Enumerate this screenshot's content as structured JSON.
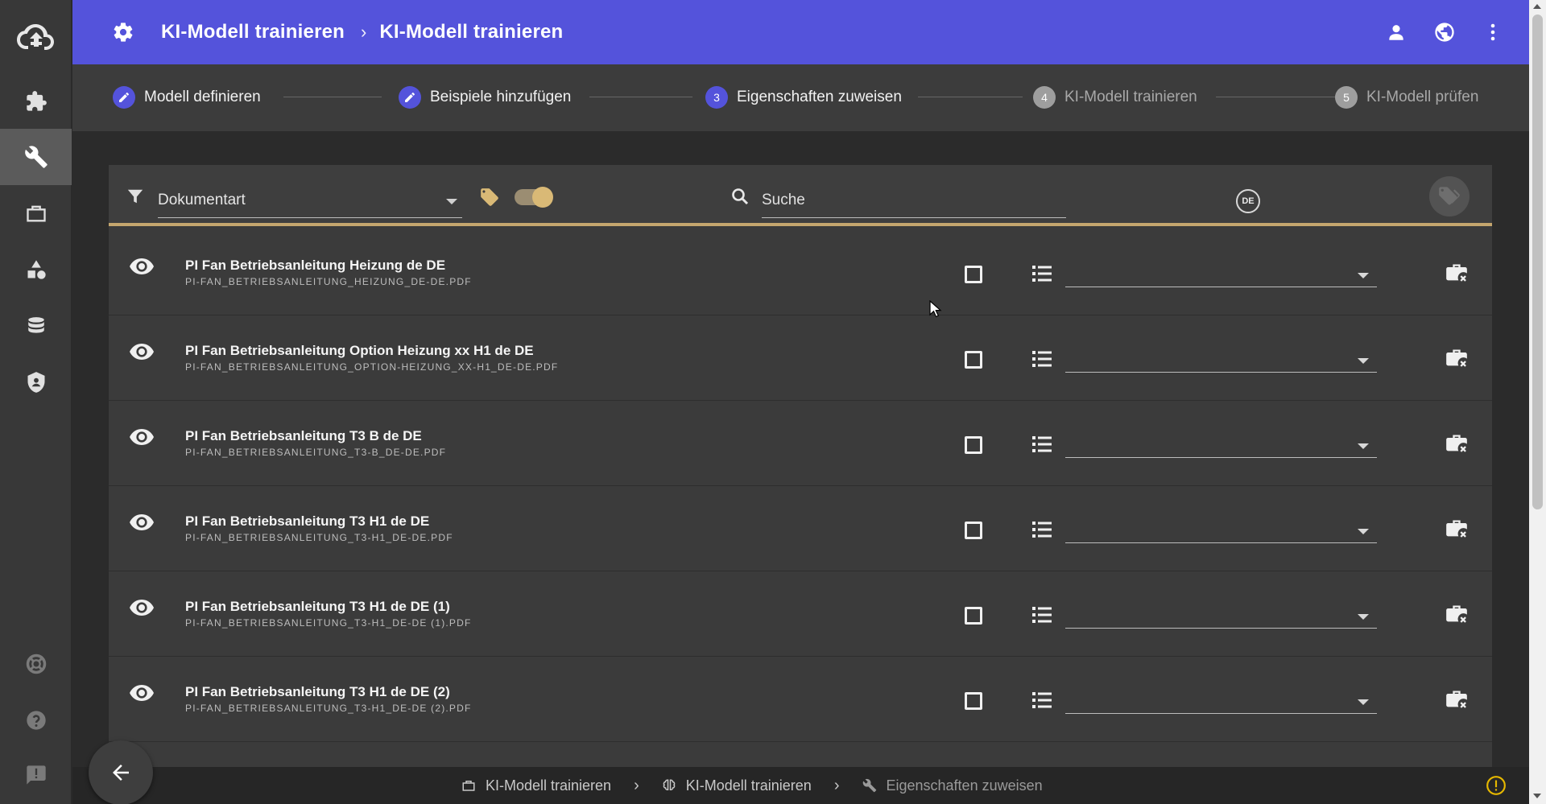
{
  "header": {
    "title": "KI-Modell trainieren",
    "separator": "›",
    "subtitle": "KI-Modell trainieren",
    "bg_color": "#5453db"
  },
  "sidebar": {
    "items": [
      {
        "icon": "puzzle-icon",
        "active": false
      },
      {
        "icon": "wrench-icon",
        "active": true
      },
      {
        "icon": "briefcase-icon",
        "active": false
      },
      {
        "icon": "shapes-icon",
        "active": false
      },
      {
        "icon": "database-icon",
        "active": false
      },
      {
        "icon": "shield-icon",
        "active": false
      }
    ],
    "bottom_items": [
      {
        "icon": "lifebuoy-icon"
      },
      {
        "icon": "help-icon"
      },
      {
        "icon": "feedback-icon"
      }
    ]
  },
  "stepper": {
    "steps": [
      {
        "label": "Modell definieren",
        "state": "done",
        "number": ""
      },
      {
        "label": "Beispiele hinzufügen",
        "state": "done",
        "number": ""
      },
      {
        "label": "Eigenschaften zuweisen",
        "state": "active",
        "number": "3"
      },
      {
        "label": "KI-Modell trainieren",
        "state": "pending",
        "number": "4"
      },
      {
        "label": "KI-Modell prüfen",
        "state": "pending",
        "number": "5"
      }
    ]
  },
  "toolbar": {
    "filter_value": "Dokumentart",
    "search_placeholder": "Suche",
    "language_badge": "DE",
    "toggle_on": true,
    "accent_color": "#c4a66e"
  },
  "rows": [
    {
      "title": "PI Fan Betriebsanleitung Heizung de DE",
      "filename": "PI-FAN_BETRIEBSANLEITUNG_HEIZUNG_DE-DE.PDF",
      "checked": false,
      "select_value": ""
    },
    {
      "title": "PI Fan Betriebsanleitung Option Heizung xx H1 de DE",
      "filename": "PI-FAN_BETRIEBSANLEITUNG_OPTION-HEIZUNG_XX-H1_DE-DE.PDF",
      "checked": false,
      "select_value": ""
    },
    {
      "title": "PI Fan Betriebsanleitung T3 B de DE",
      "filename": "PI-FAN_BETRIEBSANLEITUNG_T3-B_DE-DE.PDF",
      "checked": false,
      "select_value": ""
    },
    {
      "title": "PI Fan Betriebsanleitung T3 H1 de DE",
      "filename": "PI-FAN_BETRIEBSANLEITUNG_T3-H1_DE-DE.PDF",
      "checked": false,
      "select_value": ""
    },
    {
      "title": "PI Fan Betriebsanleitung T3 H1 de DE (1)",
      "filename": "PI-FAN_BETRIEBSANLEITUNG_T3-H1_DE-DE (1).PDF",
      "checked": false,
      "select_value": ""
    },
    {
      "title": "PI Fan Betriebsanleitung T3 H1 de DE (2)",
      "filename": "PI-FAN_BETRIEBSANLEITUNG_T3-H1_DE-DE (2).PDF",
      "checked": false,
      "select_value": ""
    }
  ],
  "footer": {
    "crumbs": [
      {
        "label": "KI-Modell trainieren",
        "icon": "briefcase-icon"
      },
      {
        "label": "KI-Modell trainieren",
        "icon": "brain-icon"
      },
      {
        "label": "Eigenschaften zuweisen",
        "icon": "wrench-icon"
      }
    ],
    "separator": "›",
    "warning_color": "#e6b800"
  }
}
